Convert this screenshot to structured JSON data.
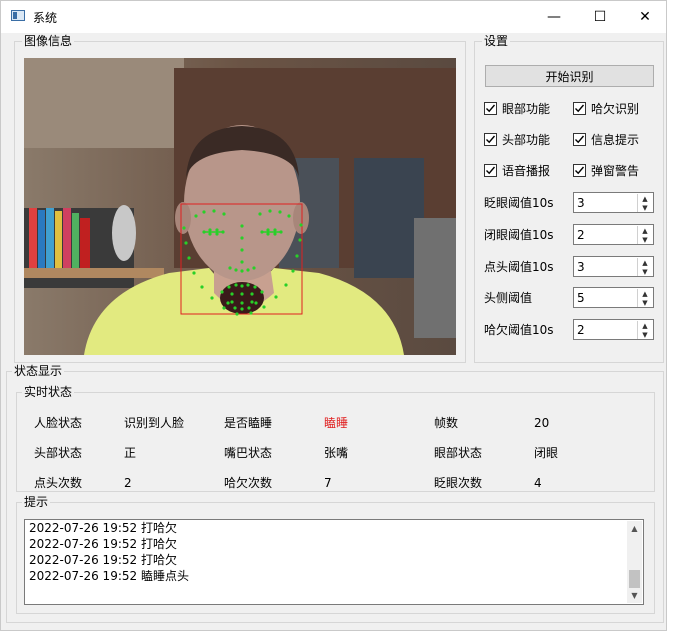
{
  "window": {
    "title": "系统",
    "minimize": "—",
    "maximize": "☐",
    "close": "✕"
  },
  "image_group": {
    "title": "图像信息"
  },
  "settings": {
    "title": "设置",
    "start_button": "开始识别",
    "checkboxes": [
      {
        "label": "眼部功能",
        "checked": true
      },
      {
        "label": "哈欠识别",
        "checked": true
      },
      {
        "label": "头部功能",
        "checked": true
      },
      {
        "label": "信息提示",
        "checked": true
      },
      {
        "label": "语音播报",
        "checked": true
      },
      {
        "label": "弹窗警告",
        "checked": true
      }
    ],
    "spinboxes": [
      {
        "label": "眨眼阈值10s",
        "value": "3"
      },
      {
        "label": "闭眼阈值10s",
        "value": "2"
      },
      {
        "label": "点头阈值10s",
        "value": "3"
      },
      {
        "label": "头侧阈值",
        "value": "5"
      },
      {
        "label": "哈欠阈值10s",
        "value": "2"
      }
    ]
  },
  "status_display": {
    "title": "状态显示",
    "realtime": {
      "title": "实时状态",
      "rows": [
        [
          {
            "label": "人脸状态",
            "value": "识别到人脸"
          },
          {
            "label": "是否瞌睡",
            "value": "瞌睡",
            "alert": true
          },
          {
            "label": "帧数",
            "value": "20"
          }
        ],
        [
          {
            "label": "头部状态",
            "value": "正"
          },
          {
            "label": "嘴巴状态",
            "value": "张嘴"
          },
          {
            "label": "眼部状态",
            "value": "闭眼"
          }
        ],
        [
          {
            "label": "点头次数",
            "value": "2"
          },
          {
            "label": "哈欠次数",
            "value": "7"
          },
          {
            "label": "眨眼次数",
            "value": "4"
          }
        ]
      ]
    },
    "hints": {
      "title": "提示",
      "lines": [
        "2022-07-26 19:52 打哈欠",
        "2022-07-26 19:52 打哈欠",
        "2022-07-26 19:52 打哈欠",
        "2022-07-26 19:52 瞌睡点头"
      ]
    }
  },
  "colors": {
    "alert": "#e02020",
    "face_box": "#e02020",
    "landmark": "#28d028"
  }
}
